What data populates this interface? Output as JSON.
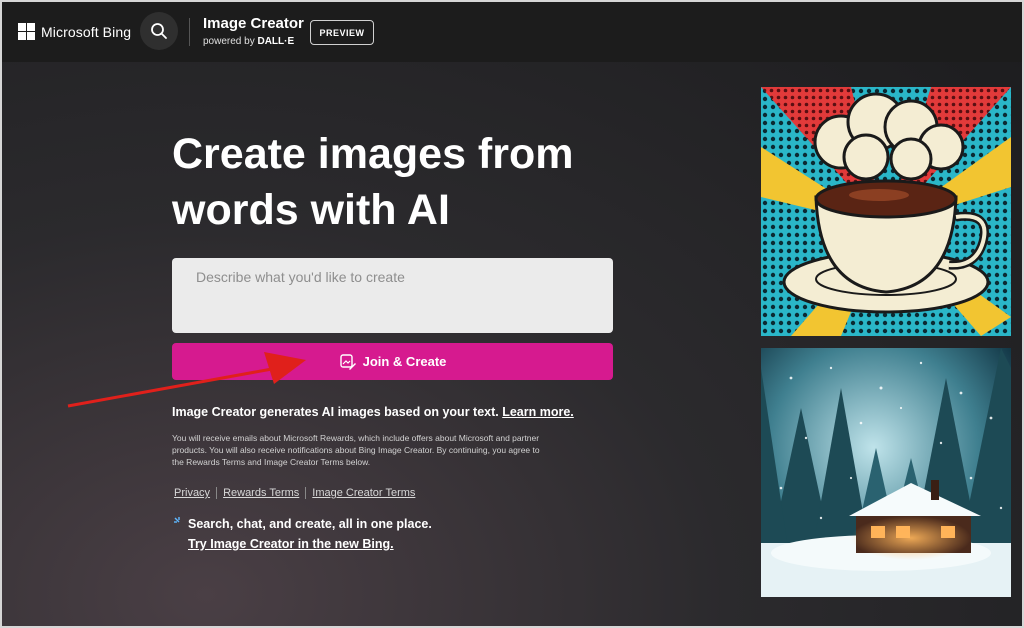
{
  "header": {
    "brand": "Microsoft Bing",
    "app_title": "Image Creator",
    "powered_prefix": "powered by",
    "powered_model": "DALL·E",
    "preview_label": "PREVIEW"
  },
  "main": {
    "headline": "Create images from words with AI",
    "prompt_placeholder": "Describe what you'd like to create",
    "create_button": "Join & Create",
    "info_text": "Image Creator generates AI images based on your text.",
    "learn_more": "Learn more.",
    "fine_print": "You will receive emails about Microsoft Rewards, which include offers about Microsoft and partner products. You will also receive notifications about Bing Image Creator. By continuing, you agree to the Rewards Terms and Image Creator Terms below.",
    "links": [
      "Privacy",
      "Rewards Terms",
      "Image Creator Terms"
    ],
    "promo_text": "Search, chat, and create, all in one place.",
    "promo_link": "Try Image Creator in the new Bing."
  },
  "colors": {
    "accent": "#d61a8f",
    "header_bg": "#1c1c1c",
    "annotation_arrow": "#e0201b"
  },
  "icons": [
    "search-icon",
    "image-create-icon",
    "sparkle-icon",
    "windows-logo-icon"
  ]
}
